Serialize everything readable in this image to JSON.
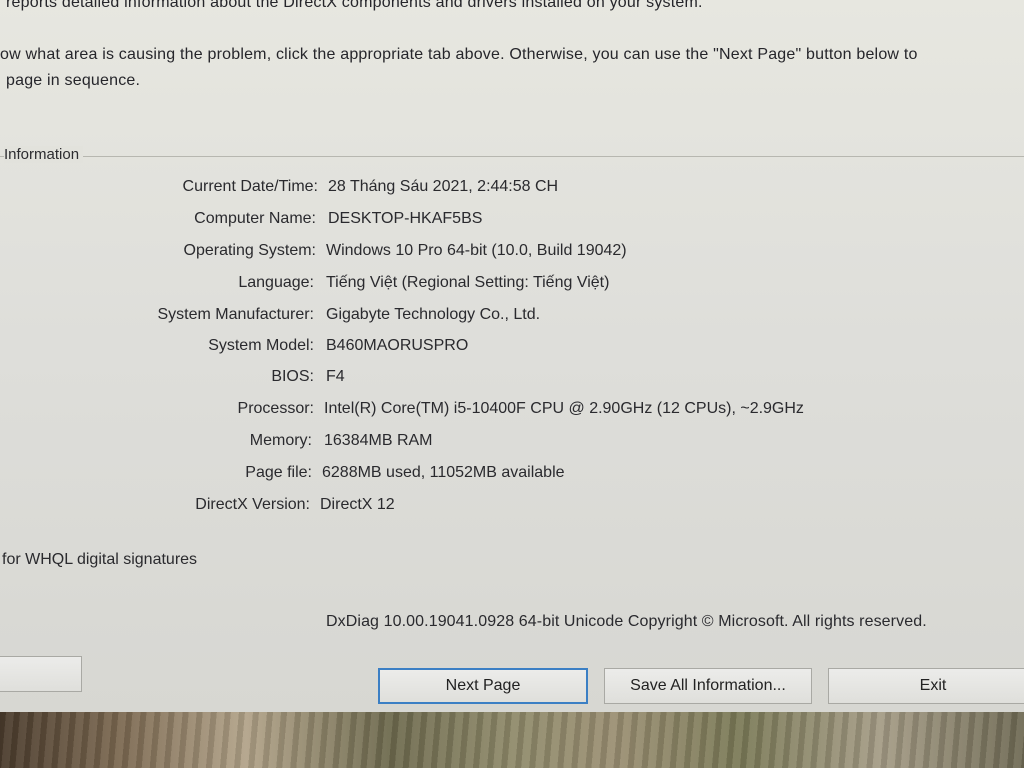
{
  "intro": {
    "line1": "reports detailed information about the DirectX components and drivers installed on your system.",
    "line2": "ow what area is causing the problem, click the appropriate tab above.  Otherwise, you can use the \"Next Page\" button below to",
    "line3": "page in sequence."
  },
  "group_title": "Information",
  "system_info": [
    {
      "label": "Current Date/Time:",
      "value": "28 Tháng Sáu 2021, 2:44:58 CH"
    },
    {
      "label": "Computer Name:",
      "value": "DESKTOP-HKAF5BS"
    },
    {
      "label": "Operating System:",
      "value": "Windows 10 Pro 64-bit (10.0, Build 19042)"
    },
    {
      "label": "Language:",
      "value": "Tiếng Việt (Regional Setting: Tiếng Việt)"
    },
    {
      "label": "System Manufacturer:",
      "value": "Gigabyte Technology Co., Ltd."
    },
    {
      "label": "System Model:",
      "value": "B460MAORUSPRO"
    },
    {
      "label": "BIOS:",
      "value": "F4"
    },
    {
      "label": "Processor:",
      "value": "Intel(R) Core(TM) i5-10400F CPU @ 2.90GHz (12 CPUs), ~2.9GHz"
    },
    {
      "label": "Memory:",
      "value": "16384MB RAM"
    },
    {
      "label": "Page file:",
      "value": "6288MB used, 11052MB available"
    },
    {
      "label": "DirectX Version:",
      "value": "DirectX 12"
    }
  ],
  "whql_text": "for WHQL digital signatures",
  "copyright": "DxDiag 10.00.19041.0928 64-bit Unicode  Copyright © Microsoft. All rights reserved.",
  "buttons": {
    "next": "Next Page",
    "save": "Save All Information...",
    "exit": "Exit"
  }
}
